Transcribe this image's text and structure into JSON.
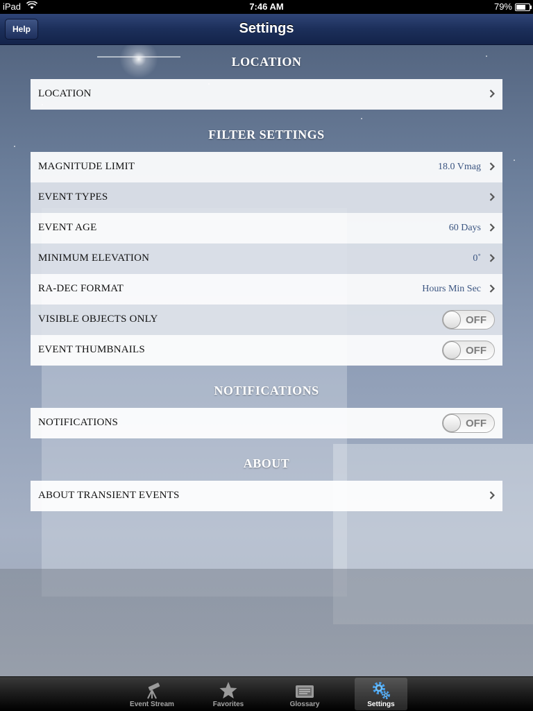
{
  "status_bar": {
    "device": "iPad",
    "time": "7:46 AM",
    "battery": "79%",
    "battery_fraction": 0.79
  },
  "nav": {
    "title": "Settings",
    "help_label": "Help"
  },
  "sections": {
    "location": {
      "header": "LOCATION",
      "rows": {
        "location": {
          "label": "LOCATION"
        }
      }
    },
    "filter": {
      "header": "FILTER SETTINGS",
      "rows": {
        "magnitude": {
          "label": "MAGNITUDE LIMIT",
          "value": "18.0 Vmag"
        },
        "event_types": {
          "label": "EVENT TYPES"
        },
        "event_age": {
          "label": "EVENT AGE",
          "value": "60 Days"
        },
        "min_elevation": {
          "label": "MINIMUM ELEVATION",
          "value": "0˚"
        },
        "ra_dec": {
          "label": "RA-DEC FORMAT",
          "value": "Hours Min Sec"
        },
        "visible_only": {
          "label": "VISIBLE OBJECTS ONLY",
          "toggle": "OFF"
        },
        "thumbnails": {
          "label": "EVENT THUMBNAILS",
          "toggle": "OFF"
        }
      }
    },
    "notifications": {
      "header": "NOTIFICATIONS",
      "rows": {
        "notifications": {
          "label": "NOTIFICATIONS",
          "toggle": "OFF"
        }
      }
    },
    "about": {
      "header": "ABOUT",
      "rows": {
        "about_transient": {
          "label": "ABOUT TRANSIENT EVENTS"
        }
      }
    }
  },
  "tabs": {
    "event_stream": {
      "label": "Event Stream",
      "icon": "telescope-icon"
    },
    "favorites": {
      "label": "Favorites",
      "icon": "star-icon"
    },
    "glossary": {
      "label": "Glossary",
      "icon": "book-icon"
    },
    "settings": {
      "label": "Settings",
      "icon": "gears-icon",
      "selected": true
    }
  },
  "colors": {
    "nav": "#1c2f5a",
    "value_text": "#3b5581",
    "tab_selected": "#ffffff"
  }
}
